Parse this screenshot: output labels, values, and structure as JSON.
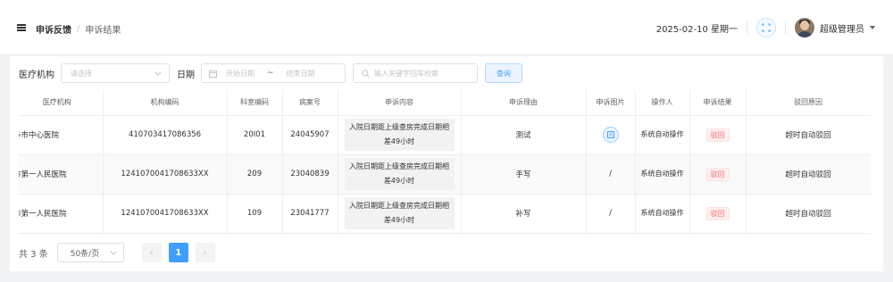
{
  "header": {
    "breadcrumb": {
      "parent": "申诉反馈",
      "separator": "/",
      "current": "申诉结果"
    },
    "date_text": "2025-02-10 星期一",
    "user_name": "超级管理员"
  },
  "filters": {
    "org_label": "医疗机构",
    "org_placeholder": "请选择",
    "date_label": "日期",
    "date_start_placeholder": "开始日期",
    "date_range_separator": "~",
    "date_end_placeholder": "结束日期",
    "keyword_placeholder": "输入关键字回车检索",
    "search_button": "查询"
  },
  "table": {
    "columns": [
      "医疗机构",
      "机构编码",
      "科室编码",
      "病案号",
      "申诉内容",
      "申诉理由",
      "申诉图片",
      "操作人",
      "申诉结果",
      "驳回原因"
    ],
    "rows": [
      {
        "org": "多市中心医院",
        "org_code": "410703417086356",
        "dept_code": "20I01",
        "case_no": "24045907",
        "content": "入院日期距上级查房完成日期相差49小时",
        "reason": "测试",
        "image": "",
        "operator": "系统自动操作",
        "result": "驳回",
        "reject_reason": "超时自动驳回"
      },
      {
        "org": "市第一人民医院",
        "org_code": "1241070041708633XX",
        "dept_code": "209",
        "case_no": "23040839",
        "content": "入院日期距上级查房完成日期相差49小时",
        "reason": "手写",
        "image": "/",
        "operator": "系统自动操作",
        "result": "驳回",
        "reject_reason": "超时自动驳回"
      },
      {
        "org": "市第一人民医院",
        "org_code": "1241070041708633XX",
        "dept_code": "109",
        "case_no": "23041777",
        "content": "入院日期距上级查房完成日期相差49小时",
        "reason": "补写",
        "image": "/",
        "operator": "系统自动操作",
        "result": "驳回",
        "reject_reason": "超时自动驳回"
      }
    ]
  },
  "pagination": {
    "total_text": "共 3 条",
    "page_size": "50条/页",
    "prev_icon": "‹",
    "current_page": "1",
    "next_icon": "›"
  },
  "icons": {
    "menu": "hamburger-menu-icon",
    "fullscreen": "fullscreen-icon",
    "dropdown": "caret-down-icon",
    "calendar": "calendar-icon",
    "search": "search-icon",
    "image": "image-icon"
  },
  "colors": {
    "primary": "#409eff",
    "danger": "#f56c6c",
    "background": "#f2f3f5"
  }
}
